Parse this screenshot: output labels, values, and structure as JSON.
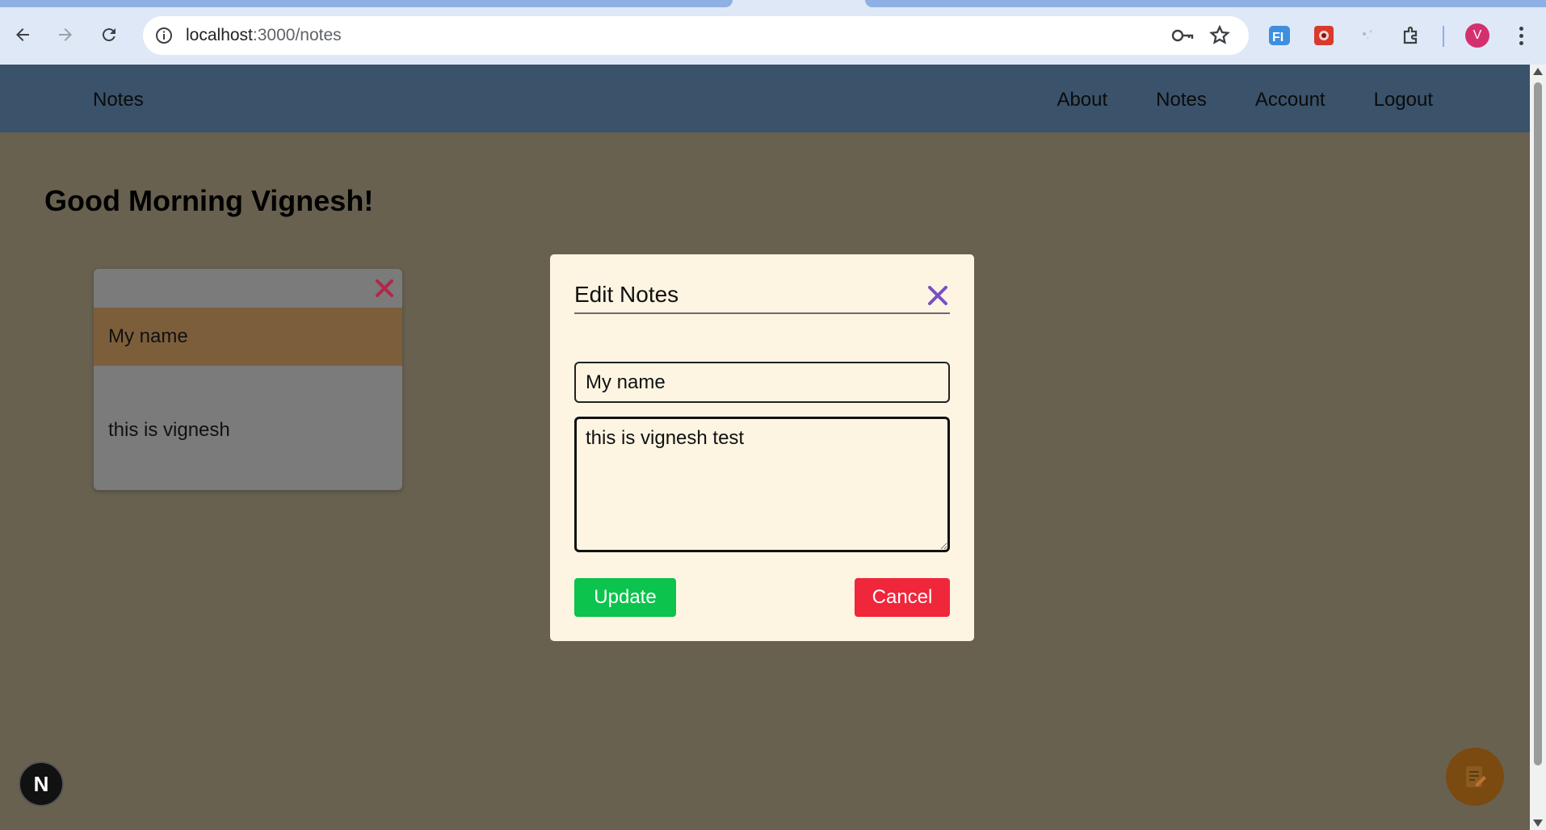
{
  "browser": {
    "url_host": "localhost",
    "url_path": ":3000/notes",
    "profile_initial": "V",
    "extensions": [
      "fi-extension-icon",
      "puzzle-game-extension-icon",
      "dots-extension-icon",
      "extensions-icon"
    ]
  },
  "nav": {
    "brand": "Notes",
    "links": [
      "About",
      "Notes",
      "Account",
      "Logout"
    ]
  },
  "greeting": "Good Morning Vignesh!",
  "note_card": {
    "title": "My name",
    "body": "this is vignesh"
  },
  "modal": {
    "title": "Edit Notes",
    "title_value": "My name",
    "body_value": "this is vignesh test",
    "update_label": "Update",
    "cancel_label": "Cancel"
  },
  "floating": {
    "next_badge": "N"
  },
  "colors": {
    "nav_bg": "#3a526a",
    "page_bg": "#686150",
    "modal_bg": "#fdf5e2",
    "update": "#0cc34d",
    "cancel": "#f0263a",
    "close_x_modal": "#7a4fc4",
    "close_x_card": "#b4254a",
    "card_title_bg": "#7d5e3b"
  }
}
